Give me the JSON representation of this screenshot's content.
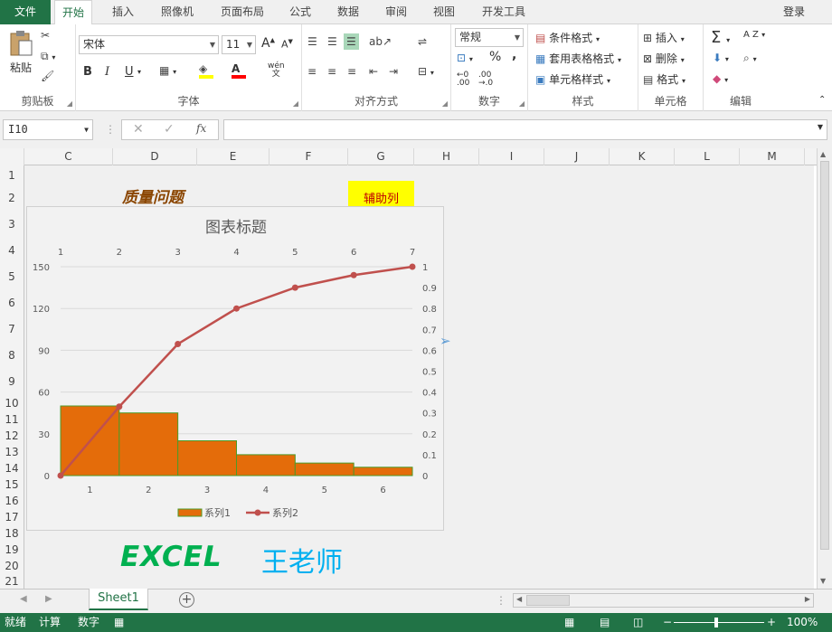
{
  "ribbon_tabs": [
    "文件",
    "开始",
    "插入",
    "照像机",
    "页面布局",
    "公式",
    "数据",
    "审阅",
    "视图",
    "开发工具"
  ],
  "login": "登录",
  "clipboard": {
    "paste": "粘贴",
    "label": "剪贴板"
  },
  "font": {
    "name": "宋体",
    "size": "11",
    "bold": "B",
    "italic": "I",
    "underline": "U",
    "label": "字体",
    "wen": "wén\n文",
    "grow": "A",
    "shrink": "A"
  },
  "alignment": {
    "label": "对齐方式"
  },
  "number": {
    "format": "常规",
    "label": "数字",
    "percent": "%",
    "comma": ","
  },
  "styles": {
    "conditional": "条件格式",
    "table": "套用表格格式",
    "cell": "单元格样式",
    "label": "样式"
  },
  "cells": {
    "insert": "插入",
    "delete": "删除",
    "format": "格式",
    "label": "单元格"
  },
  "editing": {
    "label": "编辑",
    "sort": "A Z"
  },
  "formula_bar": {
    "name_box": "I10",
    "formula": ""
  },
  "columns": [
    "C",
    "D",
    "E",
    "F",
    "G",
    "H",
    "I",
    "J",
    "K",
    "L",
    "M"
  ],
  "rows": [
    "1",
    "2",
    "3",
    "4",
    "5",
    "6",
    "7",
    "8",
    "9",
    "10",
    "11",
    "12",
    "13",
    "14",
    "15",
    "16",
    "17",
    "18",
    "19",
    "20",
    "21"
  ],
  "cells_content": {
    "title": "质量问题",
    "helper": "辅助列"
  },
  "brand": {
    "excel": "EXCEL",
    "teacher": "王老师"
  },
  "sheet_tab": "Sheet1",
  "status": {
    "ready": "就绪",
    "calc": "计算",
    "num": "数字",
    "zoom": "100%"
  },
  "colors": {
    "excel_green": "#217346",
    "bar_fill": "#e46c0a",
    "bar_border": "#4e9a28",
    "line": "#c0504d"
  },
  "chart_data": {
    "type": "bar",
    "title": "图表标题",
    "categories": [
      "1",
      "2",
      "3",
      "4",
      "5",
      "6"
    ],
    "series": [
      {
        "name": "系列1",
        "type": "bar",
        "values": [
          50,
          45,
          25,
          15,
          9,
          6
        ]
      },
      {
        "name": "系列2",
        "type": "line",
        "x": [
          1,
          2,
          3,
          4,
          5,
          6,
          7
        ],
        "values": [
          0,
          0.33,
          0.63,
          0.8,
          0.9,
          0.96,
          1.0
        ]
      }
    ],
    "ylim_primary": [
      0,
      150
    ],
    "yticks_primary": [
      "0",
      "30",
      "60",
      "90",
      "120",
      "150"
    ],
    "ylim_secondary": [
      0,
      1
    ],
    "yticks_secondary": [
      "0",
      "0.1",
      "0.2",
      "0.3",
      "0.4",
      "0.5",
      "0.6",
      "0.7",
      "0.8",
      "0.9",
      "1"
    ],
    "xticks_secondary": [
      "1",
      "2",
      "3",
      "4",
      "5",
      "6",
      "7"
    ],
    "grid": true,
    "legend": "bottom"
  }
}
